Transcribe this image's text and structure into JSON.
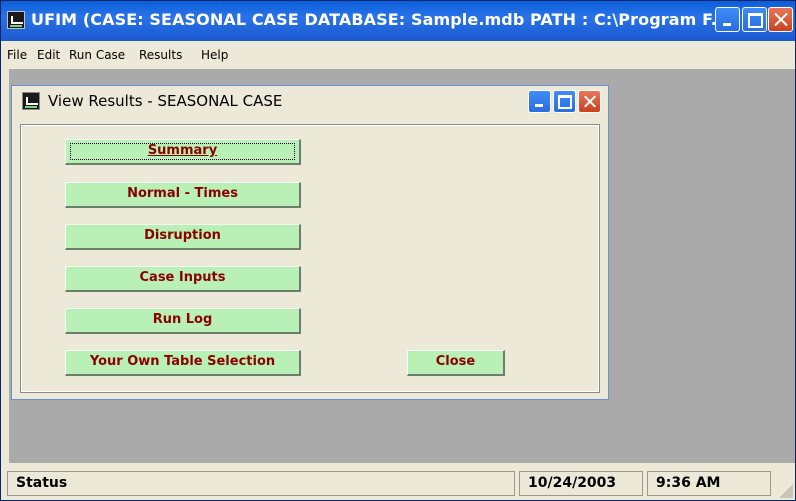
{
  "app": {
    "title": "UFIM (CASE: SEASONAL CASE    DATABASE: Sample.mdb    PATH : C:\\Program F..."
  },
  "menu": {
    "file_label": "File",
    "edit_label": "Edit",
    "run_case_label": "Run Case",
    "results_label": "Results",
    "help_label": "Help"
  },
  "dialog": {
    "title": "View Results - SEASONAL CASE",
    "buttons": {
      "summary": "Summary",
      "normal_times": "Normal - Times",
      "disruption": "Disruption",
      "case_inputs": "Case Inputs",
      "run_log": "Run Log",
      "own_table": "Your Own Table Selection",
      "close": "Close"
    }
  },
  "status": {
    "label": "Status",
    "date": "10/24/2003",
    "time": "9:36 AM"
  },
  "colors": {
    "titlebar": "#2a72e8",
    "button_face": "#b9f0b5",
    "button_text": "#8b0000",
    "client_bg": "#aaaaaa"
  }
}
